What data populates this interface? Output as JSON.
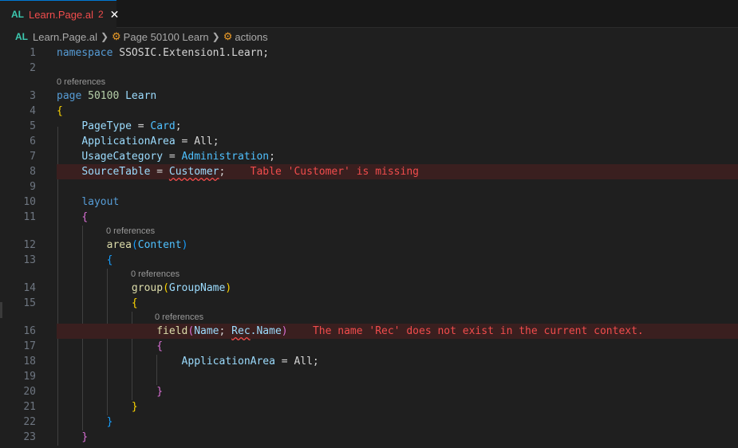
{
  "tab": {
    "lang": "AL",
    "filename": "Learn.Page.al",
    "problem_count": "2",
    "close": "✕"
  },
  "breadcrumb": {
    "lang": "AL",
    "file": "Learn.Page.al",
    "page": "Page 50100 Learn",
    "section": "actions"
  },
  "codelens": "0 references",
  "lines": {
    "l1": {
      "n": "1",
      "kw": "namespace",
      "rest": " SSOSIC.Extension1.Learn;"
    },
    "l2": {
      "n": "2"
    },
    "l3": {
      "n": "3",
      "kw": "page",
      "num": "50100",
      "name": " Learn"
    },
    "l4": {
      "n": "4",
      "brace": "{"
    },
    "l5": {
      "n": "5",
      "prop": "PageType",
      "eq": " = ",
      "val": "Card",
      "end": ";"
    },
    "l6": {
      "n": "6",
      "prop": "ApplicationArea",
      "eq": " = ",
      "val": "All",
      "end": ";"
    },
    "l7": {
      "n": "7",
      "prop": "UsageCategory",
      "eq": " = ",
      "val": "Administration",
      "end": ";"
    },
    "l8": {
      "n": "8",
      "prop": "SourceTable",
      "eq": " = ",
      "val": "Customer",
      "end": ";",
      "error": "Table 'Customer' is missing"
    },
    "l9": {
      "n": "9"
    },
    "l10": {
      "n": "10",
      "kw": "layout"
    },
    "l11": {
      "n": "11",
      "brace": "{"
    },
    "l12": {
      "n": "12",
      "fn": "area",
      "open": "(",
      "arg": "Content",
      "close": ")"
    },
    "l13": {
      "n": "13",
      "brace": "{"
    },
    "l14": {
      "n": "14",
      "fn": "group",
      "open": "(",
      "arg": "GroupName",
      "close": ")"
    },
    "l15": {
      "n": "15",
      "brace": "{"
    },
    "l16": {
      "n": "16",
      "fn": "field",
      "open": "(",
      "arg1": "Name",
      "semi": "; ",
      "rec": "Rec",
      "dot": ".Name",
      "close": ")",
      "error": "The name 'Rec' does not exist in the current context."
    },
    "l17": {
      "n": "17",
      "brace": "{"
    },
    "l18": {
      "n": "18",
      "prop": "ApplicationArea",
      "eq": " = ",
      "val": "All",
      "end": ";"
    },
    "l19": {
      "n": "19"
    },
    "l20": {
      "n": "20",
      "brace": "}"
    },
    "l21": {
      "n": "21",
      "brace": "}"
    },
    "l22": {
      "n": "22",
      "brace": "}"
    },
    "l23": {
      "n": "23",
      "brace": "}"
    }
  }
}
